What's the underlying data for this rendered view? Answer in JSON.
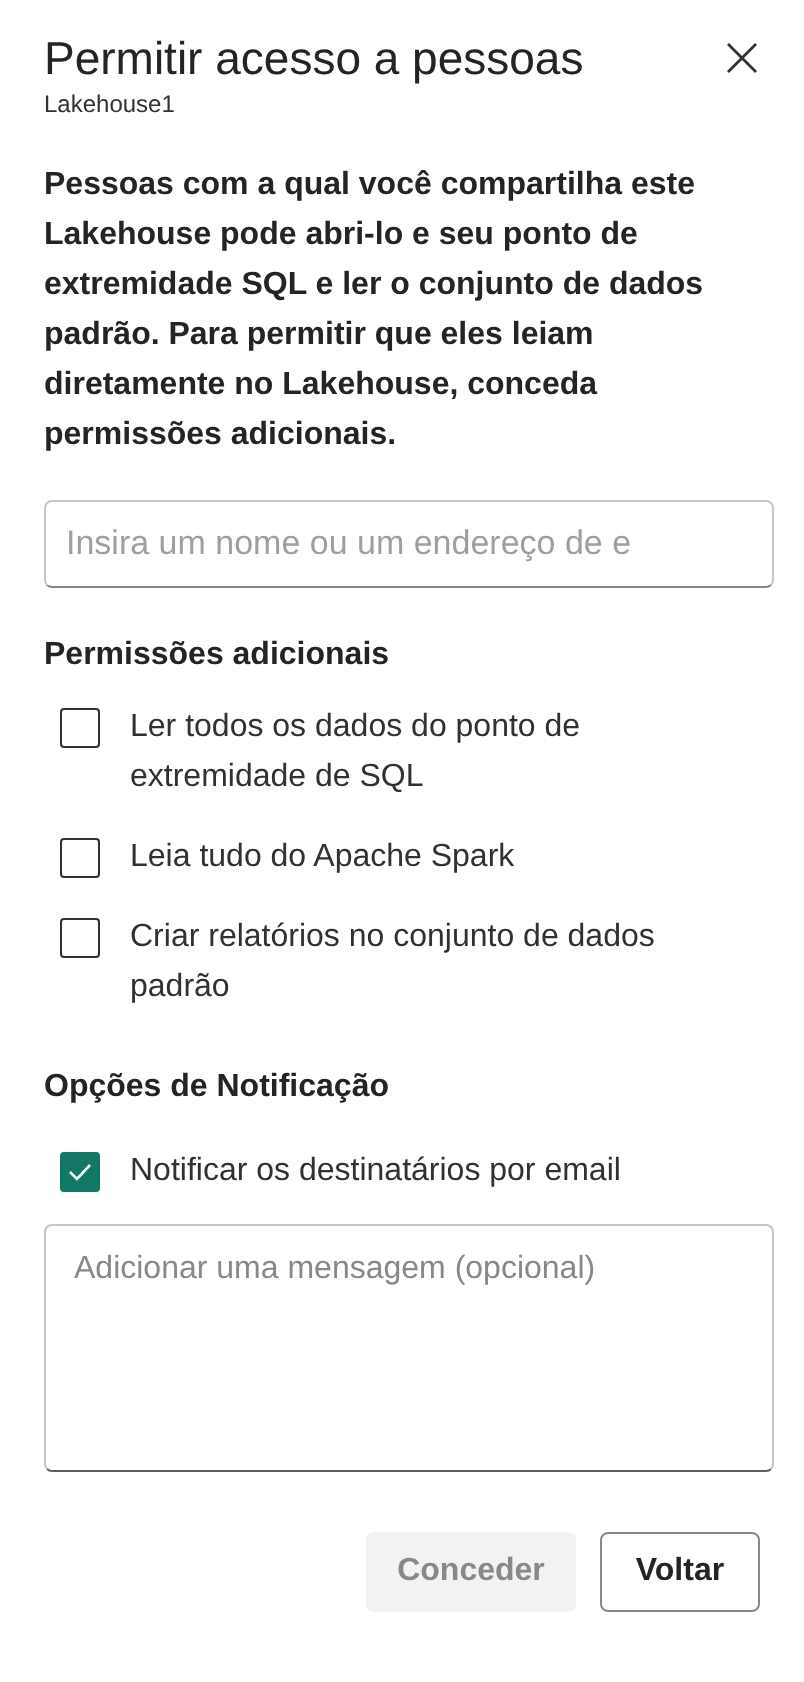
{
  "dialog": {
    "title": "Permitir acesso a pessoas",
    "subtitle": "Lakehouse1"
  },
  "description": "Pessoas com a qual você compartilha este Lakehouse pode abri-lo e seu ponto de extremidade SQL e ler o conjunto de dados padrão. Para permitir que eles leiam diretamente no Lakehouse, conceda permissões adicionais.",
  "search": {
    "placeholder": "Insira um nome ou um endereço de e"
  },
  "permissions": {
    "heading": "Permissões adicionais",
    "items": [
      {
        "label": "Ler todos os dados do ponto de extremidade de SQL",
        "checked": false
      },
      {
        "label": "Leia tudo do Apache Spark",
        "checked": false
      },
      {
        "label": "Criar relatórios no conjunto de dados padrão",
        "checked": false
      }
    ]
  },
  "notifications": {
    "heading": "Opções de Notificação",
    "items": [
      {
        "label": "Notificar os destinatários por email",
        "checked": true
      }
    ],
    "message": {
      "placeholder": "Adicionar uma mensagem (opcional)"
    }
  },
  "buttons": [
    {
      "label": "Conceder",
      "disabled": true
    },
    {
      "label": "Voltar",
      "disabled": false
    }
  ]
}
